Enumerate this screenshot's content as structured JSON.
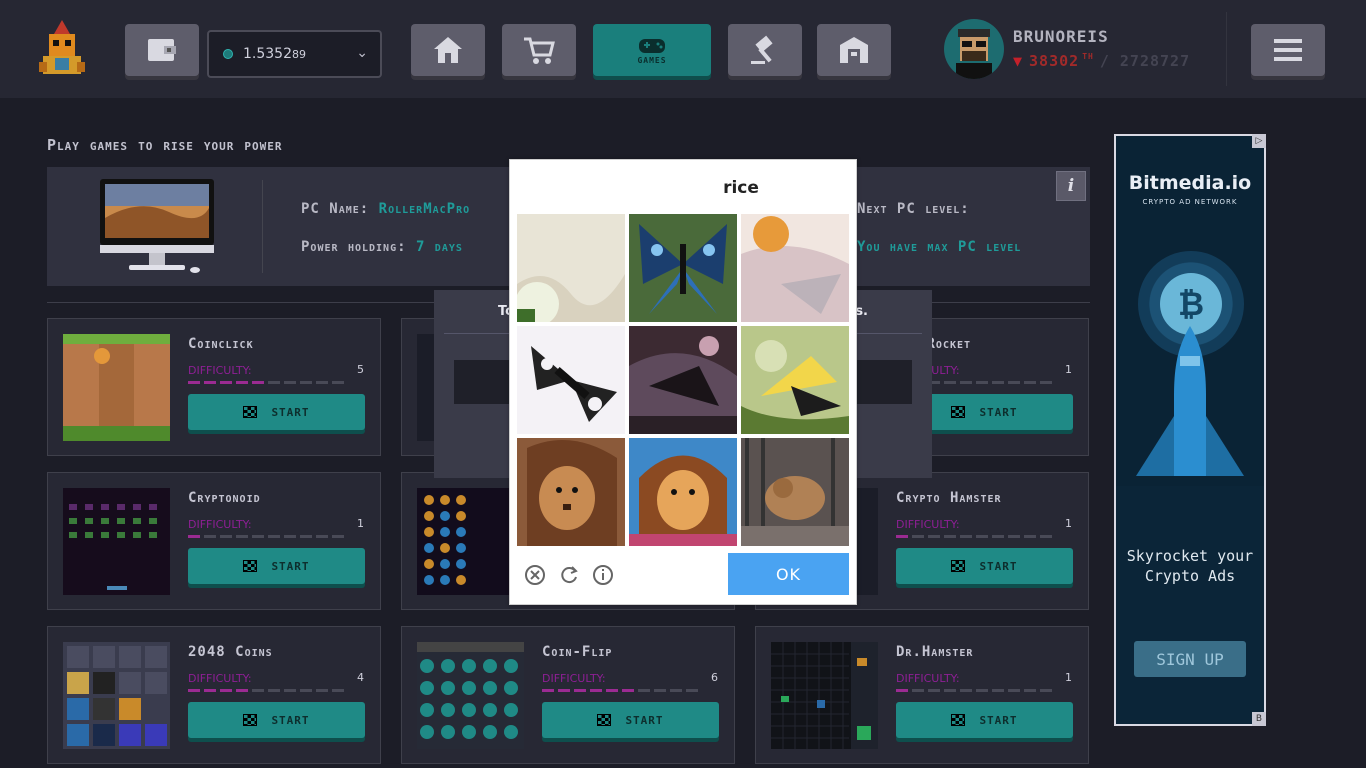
{
  "header": {
    "wallet": {
      "balance_main": "1.5352",
      "balance_small": "89"
    },
    "nav": [
      {
        "name": "home"
      },
      {
        "name": "cart"
      },
      {
        "name": "games",
        "label": "GAMES"
      },
      {
        "name": "auction"
      },
      {
        "name": "hall"
      }
    ],
    "user": {
      "name": "BRUNOREIS",
      "power": "38302",
      "unit": "TH",
      "total": "/ 2728727"
    }
  },
  "page": {
    "title": "Play games to rise your power",
    "pc_name_label": "PC Name:",
    "pc_name_value": "RollerMacPro",
    "power_label": "Power holding:",
    "power_value": "7 days",
    "next_label": "Next PC level:",
    "next_value": "You have max PC level"
  },
  "games": [
    {
      "name": "Coinclick",
      "difficulty": 5
    },
    {
      "name": "",
      "difficulty": null
    },
    {
      "name": "ppy Rocket",
      "difficulty": 1
    },
    {
      "name": "Cryptonoid",
      "difficulty": 1
    },
    {
      "name": "",
      "difficulty": null
    },
    {
      "name": "Crypto Hamster",
      "difficulty": 1
    },
    {
      "name": "2048 Coins",
      "difficulty": 4
    },
    {
      "name": "Coin-Flip",
      "difficulty": 6
    },
    {
      "name": "Dr.Hamster",
      "difficulty": 1
    }
  ],
  "difficulty_label": "DIFFICULTY:",
  "start_label": "START",
  "bg_modal": {
    "text_left": "To",
    "text_right": "s."
  },
  "captcha": {
    "word": "rice",
    "ok_label": "OK"
  },
  "ad": {
    "logo": "Bitmedia.io",
    "subtitle": "CRYPTO AD NETWORK",
    "copy": "Skyrocket your Crypto Ads",
    "cta": "SIGN UP"
  },
  "colors": {
    "accent": "#1f8a86",
    "difficulty": "#9b2b92",
    "power_down": "#c4202a",
    "ok": "#4aa3f2"
  }
}
